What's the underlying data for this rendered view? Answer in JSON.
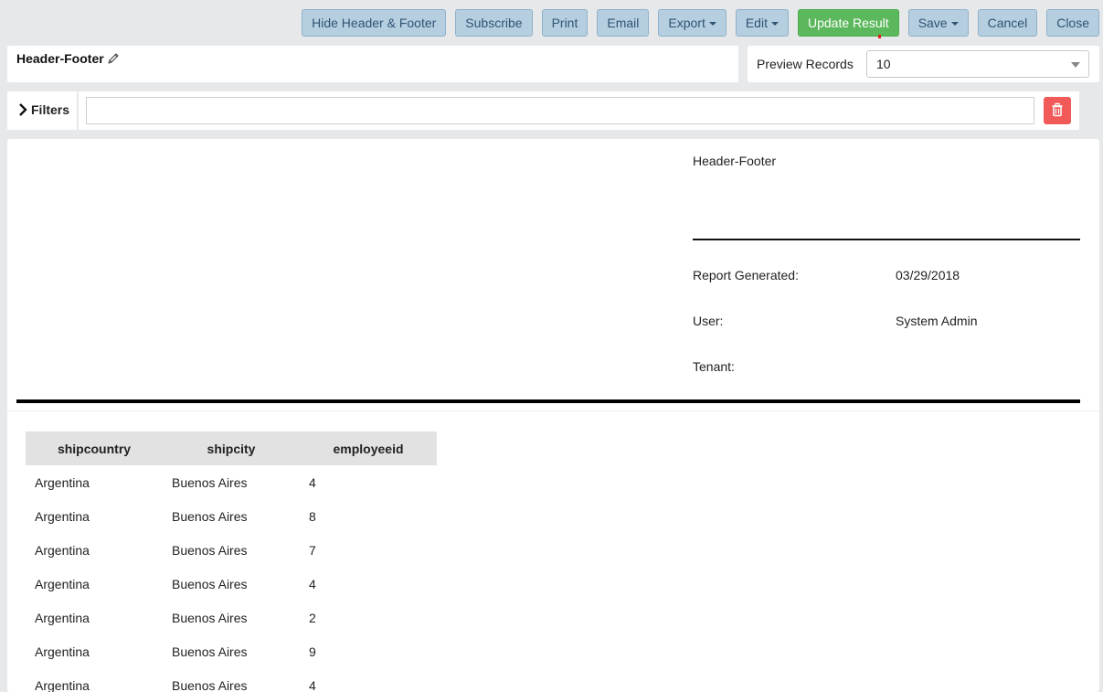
{
  "toolbar": {
    "hide_header_footer": "Hide Header & Footer",
    "subscribe": "Subscribe",
    "print": "Print",
    "email": "Email",
    "export": "Export",
    "edit": "Edit",
    "update_result": "Update Result",
    "save": "Save",
    "cancel": "Cancel",
    "close": "Close"
  },
  "report": {
    "title": "Header-Footer"
  },
  "preview": {
    "label": "Preview Records",
    "selected": "10"
  },
  "filters": {
    "label": "Filters",
    "input_value": ""
  },
  "header_block": {
    "title": "Header-Footer",
    "generated_label": "Report Generated:",
    "generated_value": "03/29/2018",
    "user_label": "User:",
    "user_value": "System Admin",
    "tenant_label": "Tenant:",
    "tenant_value": ""
  },
  "table": {
    "columns": [
      "shipcountry",
      "shipcity",
      "employeeid"
    ],
    "rows": [
      [
        "Argentina",
        "Buenos Aires",
        "4"
      ],
      [
        "Argentina",
        "Buenos Aires",
        "8"
      ],
      [
        "Argentina",
        "Buenos Aires",
        "7"
      ],
      [
        "Argentina",
        "Buenos Aires",
        "4"
      ],
      [
        "Argentina",
        "Buenos Aires",
        "2"
      ],
      [
        "Argentina",
        "Buenos Aires",
        "9"
      ],
      [
        "Argentina",
        "Buenos Aires",
        "4"
      ]
    ]
  },
  "colors": {
    "toolbar_button_bg": "#b6cfe0",
    "toolbar_button_text": "#2f5373",
    "primary_button_bg": "#5cb85c",
    "delete_button_bg": "#f25a5a",
    "page_bg": "#e6e8ea"
  },
  "icons": {
    "title_edit": "pencil-icon",
    "filters_toggle": "chevron-right-icon",
    "filters_clear": "trash-icon",
    "preview_dropdown": "chevron-down-icon"
  }
}
